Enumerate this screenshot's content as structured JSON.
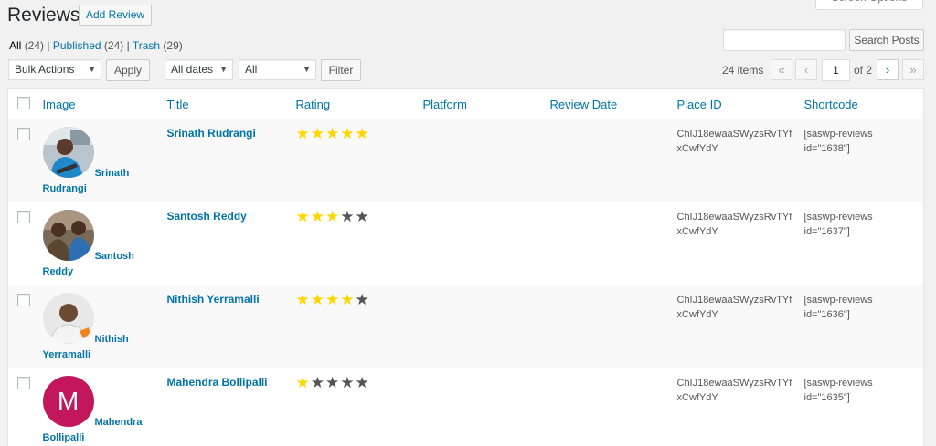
{
  "header": {
    "title": "Reviews",
    "add_button": "Add Review",
    "screen_options": "Screen Options"
  },
  "filters": {
    "all": "All",
    "all_count": "(24)",
    "published": "Published",
    "published_count": "(24)",
    "trash": "Trash",
    "trash_count": "(29)",
    "sep": "|"
  },
  "search": {
    "value": "",
    "button": "Search Posts"
  },
  "bulk": {
    "selected": "Bulk Actions",
    "apply": "Apply"
  },
  "dates": {
    "selected": "All dates"
  },
  "category": {
    "selected": "All"
  },
  "filter_button": "Filter",
  "pagination": {
    "items": "24 items",
    "first": "«",
    "prev": "‹",
    "current": "1",
    "of": "of 2",
    "next": "›",
    "last": "»"
  },
  "columns": [
    "Image",
    "Title",
    "Rating",
    "Platform",
    "Review Date",
    "Place ID",
    "Shortcode"
  ],
  "rows": [
    {
      "name_l1": "Srinath",
      "name_l2": "Rudrangi",
      "title": "Srinath Rudrangi",
      "rating": 5,
      "place_id_1": "ChIJ18ewaaSWyzsRvTYf",
      "place_id_2": "xCwfYdY",
      "shortcode_1": "[saswp-reviews",
      "shortcode_2": "id=\"1638\"]",
      "avatar": "photo-person-1"
    },
    {
      "name_l1": "Santosh",
      "name_l2": "Reddy",
      "title": "Santosh Reddy",
      "rating": 3,
      "place_id_1": "ChIJ18ewaaSWyzsRvTYf",
      "place_id_2": "xCwfYdY",
      "shortcode_1": "[saswp-reviews",
      "shortcode_2": "id=\"1637\"]",
      "avatar": "photo-person-2"
    },
    {
      "name_l1": "Nithish",
      "name_l2": "Yerramalli",
      "title": "Nithish Yerramalli",
      "rating": 4,
      "place_id_1": "ChIJ18ewaaSWyzsRvTYf",
      "place_id_2": "xCwfYdY",
      "shortcode_1": "[saswp-reviews",
      "shortcode_2": "id=\"1636\"]",
      "avatar": "photo-person-3"
    },
    {
      "name_l1": "Mahendra",
      "name_l2": "Bollipalli",
      "title": "Mahendra Bollipalli",
      "rating": 1,
      "place_id_1": "ChIJ18ewaaSWyzsRvTYf",
      "place_id_2": "xCwfYdY",
      "shortcode_1": "[saswp-reviews",
      "shortcode_2": "id=\"1635\"]",
      "avatar": "letter-avatar",
      "avatar_letter": "M"
    }
  ],
  "colors": {
    "link": "#0073aa",
    "star_on": "#ffd700",
    "star_off": "#555555",
    "avatar_m": "#c2185b"
  }
}
